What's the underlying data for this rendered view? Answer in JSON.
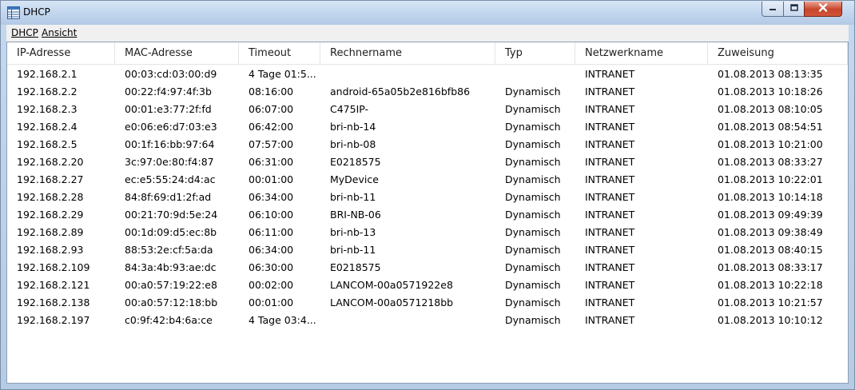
{
  "window": {
    "title": "DHCP"
  },
  "menu": {
    "items": [
      "DHCP",
      "Ansicht"
    ]
  },
  "table": {
    "columns": [
      "IP-Adresse",
      "MAC-Adresse",
      "Timeout",
      "Rechnername",
      "Typ",
      "Netzwerkname",
      "Zuweisung"
    ],
    "rows": [
      [
        "192.168.2.1",
        "00:03:cd:03:00:d9",
        "4 Tage 01:5...",
        "",
        "",
        "INTRANET",
        "01.08.2013 08:13:35"
      ],
      [
        "192.168.2.2",
        "00:22:f4:97:4f:3b",
        "08:16:00",
        "android-65a05b2e816bfb86",
        "Dynamisch",
        "INTRANET",
        "01.08.2013 10:18:26"
      ],
      [
        "192.168.2.3",
        "00:01:e3:77:2f:fd",
        "06:07:00",
        "C475IP-",
        "Dynamisch",
        "INTRANET",
        "01.08.2013 08:10:05"
      ],
      [
        "192.168.2.4",
        "e0:06:e6:d7:03:e3",
        "06:42:00",
        "bri-nb-14",
        "Dynamisch",
        "INTRANET",
        "01.08.2013 08:54:51"
      ],
      [
        "192.168.2.5",
        "00:1f:16:bb:97:64",
        "07:57:00",
        "bri-nb-08",
        "Dynamisch",
        "INTRANET",
        "01.08.2013 10:21:00"
      ],
      [
        "192.168.2.20",
        "3c:97:0e:80:f4:87",
        "06:31:00",
        "E0218575",
        "Dynamisch",
        "INTRANET",
        "01.08.2013 08:33:27"
      ],
      [
        "192.168.2.27",
        "ec:e5:55:24:d4:ac",
        "00:01:00",
        "MyDevice",
        "Dynamisch",
        "INTRANET",
        "01.08.2013 10:22:01"
      ],
      [
        "192.168.2.28",
        "84:8f:69:d1:2f:ad",
        "06:34:00",
        "bri-nb-11",
        "Dynamisch",
        "INTRANET",
        "01.08.2013 10:14:18"
      ],
      [
        "192.168.2.29",
        "00:21:70:9d:5e:24",
        "06:10:00",
        "BRI-NB-06",
        "Dynamisch",
        "INTRANET",
        "01.08.2013 09:49:39"
      ],
      [
        "192.168.2.89",
        "00:1d:09:d5:ec:8b",
        "06:11:00",
        "bri-nb-13",
        "Dynamisch",
        "INTRANET",
        "01.08.2013 09:38:49"
      ],
      [
        "192.168.2.93",
        "88:53:2e:cf:5a:da",
        "06:34:00",
        "bri-nb-11",
        "Dynamisch",
        "INTRANET",
        "01.08.2013 08:40:15"
      ],
      [
        "192.168.2.109",
        "84:3a:4b:93:ae:dc",
        "06:30:00",
        "E0218575",
        "Dynamisch",
        "INTRANET",
        "01.08.2013 08:33:17"
      ],
      [
        "192.168.2.121",
        "00:a0:57:19:22:e8",
        "00:02:00",
        "LANCOM-00a0571922e8",
        "Dynamisch",
        "INTRANET",
        "01.08.2013 10:22:18"
      ],
      [
        "192.168.2.138",
        "00:a0:57:12:18:bb",
        "00:01:00",
        "LANCOM-00a0571218bb",
        "Dynamisch",
        "INTRANET",
        "01.08.2013 10:21:57"
      ],
      [
        "192.168.2.197",
        "c0:9f:42:b4:6a:ce",
        "4 Tage 03:4...",
        "",
        "Dynamisch",
        "INTRANET",
        "01.08.2013 10:10:12"
      ]
    ]
  },
  "icons": {
    "app": "table-icon",
    "minimize": "minimize-icon",
    "maximize": "maximize-icon",
    "close": "close-icon"
  },
  "colors": {
    "close_button": "#c8452b",
    "titlebar": "#c2d6ee"
  }
}
